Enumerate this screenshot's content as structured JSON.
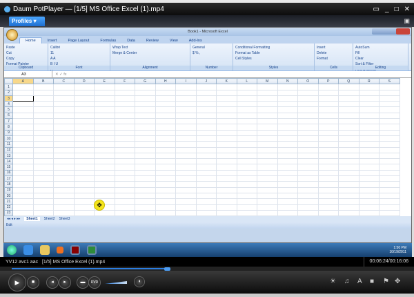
{
  "window": {
    "title": "Daum PotPlayer",
    "separator": "—",
    "file_title": "[1/5] MS Office Excel (1).mp4",
    "controls": [
      "▭",
      "_",
      "□",
      "✕"
    ]
  },
  "profiles": {
    "label": "Profiles ▾"
  },
  "excel": {
    "title": "Book1 - Microsoft Excel",
    "tabs": [
      "Home",
      "Insert",
      "Page Layout",
      "Formulas",
      "Data",
      "Review",
      "View",
      "Add-Ins"
    ],
    "groups": [
      {
        "label": "Clipboard",
        "items": [
          "Paste",
          "Cut",
          "Copy",
          "Format Painter"
        ]
      },
      {
        "label": "Font",
        "items": [
          "Calibri",
          "11",
          "A A",
          "B I U",
          "A"
        ]
      },
      {
        "label": "Alignment",
        "items": [
          "Wrap Text",
          "Merge & Center"
        ]
      },
      {
        "label": "Number",
        "items": [
          "General",
          "$ % ,"
        ]
      },
      {
        "label": "Styles",
        "items": [
          "Conditional Formatting",
          "Format as Table",
          "Cell Styles"
        ]
      },
      {
        "label": "Cells",
        "items": [
          "Insert",
          "Delete",
          "Format"
        ]
      },
      {
        "label": "Editing",
        "items": [
          "AutoSum",
          "Fill",
          "Clear",
          "Sort & Filter",
          "Find & Select"
        ]
      }
    ],
    "name_box": "A3",
    "fx": "✕ ✓ fx",
    "columns": [
      "A",
      "B",
      "C",
      "D",
      "E",
      "F",
      "G",
      "H",
      "I",
      "J",
      "K",
      "L",
      "M",
      "N",
      "O",
      "P",
      "Q",
      "R",
      "S"
    ],
    "rows": [
      "1",
      "2",
      "3",
      "4",
      "5",
      "6",
      "7",
      "8",
      "9",
      "10",
      "11",
      "12",
      "13",
      "14",
      "15",
      "16",
      "17",
      "18",
      "19",
      "20",
      "21",
      "22",
      "23"
    ],
    "active_cell": "A3",
    "sheet_tabs": [
      "Sheet1",
      "Sheet2",
      "Sheet3"
    ],
    "status": "Edit"
  },
  "taskbar": {
    "time": "1:50 PM",
    "date": "10/19/2011"
  },
  "info": {
    "codec": "YV12  avc1    aac",
    "file": "[1/5] MS Office Excel (1).mp4",
    "time": "00:06:24/00:16:06"
  },
  "playback": {
    "progress": 0.397,
    "volume": 0.8
  },
  "icon_names": [
    "play-icon",
    "stop-icon",
    "prev-icon",
    "next-icon",
    "open-icon",
    "dvd-icon",
    "mute-icon",
    "brightness-icon",
    "audio-icon",
    "subtitle-icon",
    "capture-icon",
    "bookmark-icon",
    "move-icon"
  ]
}
